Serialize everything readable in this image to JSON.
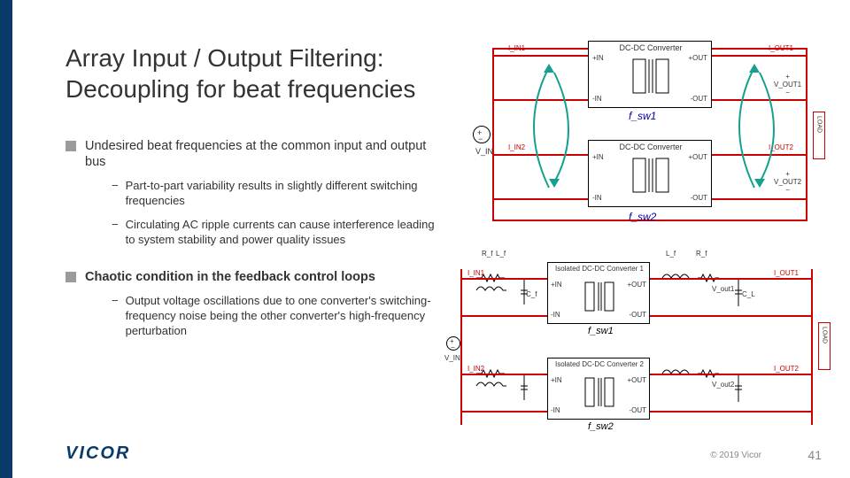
{
  "title_line1": "Array Input / Output Filtering:",
  "title_line2": "Decoupling for beat frequencies",
  "bullets": {
    "b1": "Undesired beat frequencies at the common input and output bus",
    "b1_sub1": "Part-to-part variability results in slightly different switching frequencies",
    "b1_sub2": "Circulating AC ripple currents can cause interference leading to system stability and power quality issues",
    "b2": "Chaotic condition in the feedback control loops",
    "b2_sub1": "Output voltage oscillations due to one converter's switching-frequency noise being the other converter's high-frequency perturbation"
  },
  "diagram_top": {
    "conv_label": "DC-DC Converter",
    "pins": {
      "pin_in_p": "+IN",
      "pin_in_n": "-IN",
      "pin_out_p": "+OUT",
      "pin_out_n": "-OUT"
    },
    "iin1": "I_IN1",
    "iin2": "I_IN2",
    "iout1": "I_OUT1",
    "iout2": "I_OUT2",
    "vin": "V_IN",
    "vout1": "V_OUT1",
    "vout2": "V_OUT2",
    "fsw1": "f_sw1",
    "fsw2": "f_sw2",
    "load": "LOAD"
  },
  "diagram_bot": {
    "vin": "V_IN",
    "conv1": "Isolated DC-DC Converter 1",
    "conv2": "Isolated DC-DC Converter 2",
    "pins": {
      "pin_in_p": "+IN",
      "pin_in_n": "-IN",
      "pin_out_p": "+OUT",
      "pin_out_n": "-OUT"
    },
    "fsw1": "f_sw1",
    "fsw2": "f_sw2",
    "vout1": "V_out1",
    "vout2": "V_out2",
    "rf": "R_f",
    "lf": "L_f",
    "cf": "C_f",
    "cl": "C_L",
    "load": "LOAD",
    "iin1": "I_IN1",
    "iin2": "I_IN2",
    "iout1": "I_OUT1",
    "iout2": "I_OUT2"
  },
  "footer": {
    "logo": "VICOR",
    "copyright": "© 2019 Vicor",
    "page": "41"
  }
}
